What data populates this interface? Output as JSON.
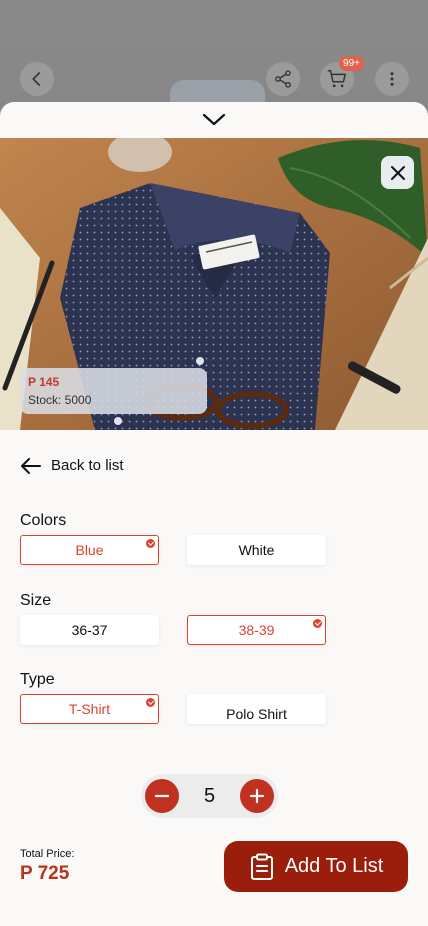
{
  "header": {
    "cart_badge": "99+"
  },
  "product": {
    "price": "P 145",
    "stock": "Stock: 5000"
  },
  "nav": {
    "back_label": "Back to list"
  },
  "colors": {
    "label": "Colors",
    "options": [
      "Blue",
      "White"
    ],
    "selected": "Blue"
  },
  "size": {
    "label": "Size",
    "options": [
      "36-37",
      "38-39"
    ],
    "selected": "38-39"
  },
  "type": {
    "label": "Type",
    "options": [
      "T-Shirt",
      "Polo Shirt"
    ],
    "selected": "T-Shirt"
  },
  "quantity": {
    "value": "5"
  },
  "total": {
    "label": "Total Price:",
    "value": "P 725"
  },
  "cta": {
    "label": "Add To List"
  },
  "theme": {
    "accent": "#d9442e",
    "cta_bg": "#9b1e0c"
  },
  "icons": [
    "back-arrow-icon",
    "share-icon",
    "cart-icon",
    "more-vert-icon",
    "chevron-down-icon",
    "close-icon",
    "arrow-left-icon",
    "check-icon",
    "minus-icon",
    "plus-icon",
    "clipboard-icon"
  ]
}
